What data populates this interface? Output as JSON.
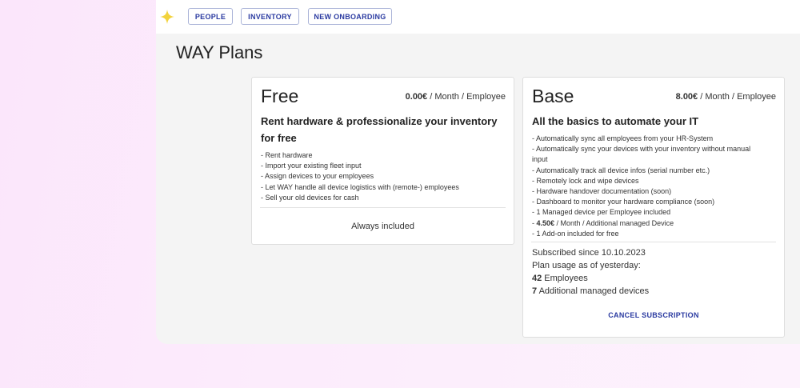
{
  "nav": {
    "buttons": [
      {
        "label": "PEOPLE"
      },
      {
        "label": "INVENTORY"
      },
      {
        "label": "NEW ONBOARDING"
      }
    ]
  },
  "page": {
    "title": "WAY Plans"
  },
  "colors": {
    "accent": "#2a3aa0",
    "sparkle": "#f2d23b"
  },
  "plans": [
    {
      "name": "Free",
      "price_value": "0.00€",
      "price_unit": " / Month / Employee",
      "headline": "Rent hardware & professionalize your inventory for free",
      "features": [
        "- Rent hardware",
        "- Import your existing fleet input",
        "- Assign devices to your employees",
        "- Let WAY handle all device logistics with (remote-) employees",
        "- Sell your old devices for cash"
      ],
      "footer": "Always included"
    },
    {
      "name": "Base",
      "price_value": "8.00€",
      "price_unit": " / Month / Employee",
      "headline": "All the basics to automate your IT",
      "features": [
        "- Automatically sync all employees from your HR-System",
        "- Automatically sync your devices with your inventory without manual",
        "input",
        "- Automatically track all device infos (serial number etc.)",
        "- Remotely lock and wipe devices",
        "- Hardware handover documentation (soon)",
        "- Dashboard to monitor your hardware compliance (soon)",
        "- 1 Managed device per Employee included"
      ],
      "extra_prefix": "- ",
      "extra_price": "4.50€",
      "extra_suffix": " / Month / Additional managed Device",
      "addon": "- 1 Add-on included for free",
      "subscribed": "Subscribed since 10.10.2023",
      "usage_label": "Plan usage as of yesterday:",
      "employees_count": "42",
      "employees_label": " Employees",
      "devices_count": "7",
      "devices_label": " Additional managed devices",
      "cancel": "CANCEL SUBSCRIPTION"
    }
  ]
}
